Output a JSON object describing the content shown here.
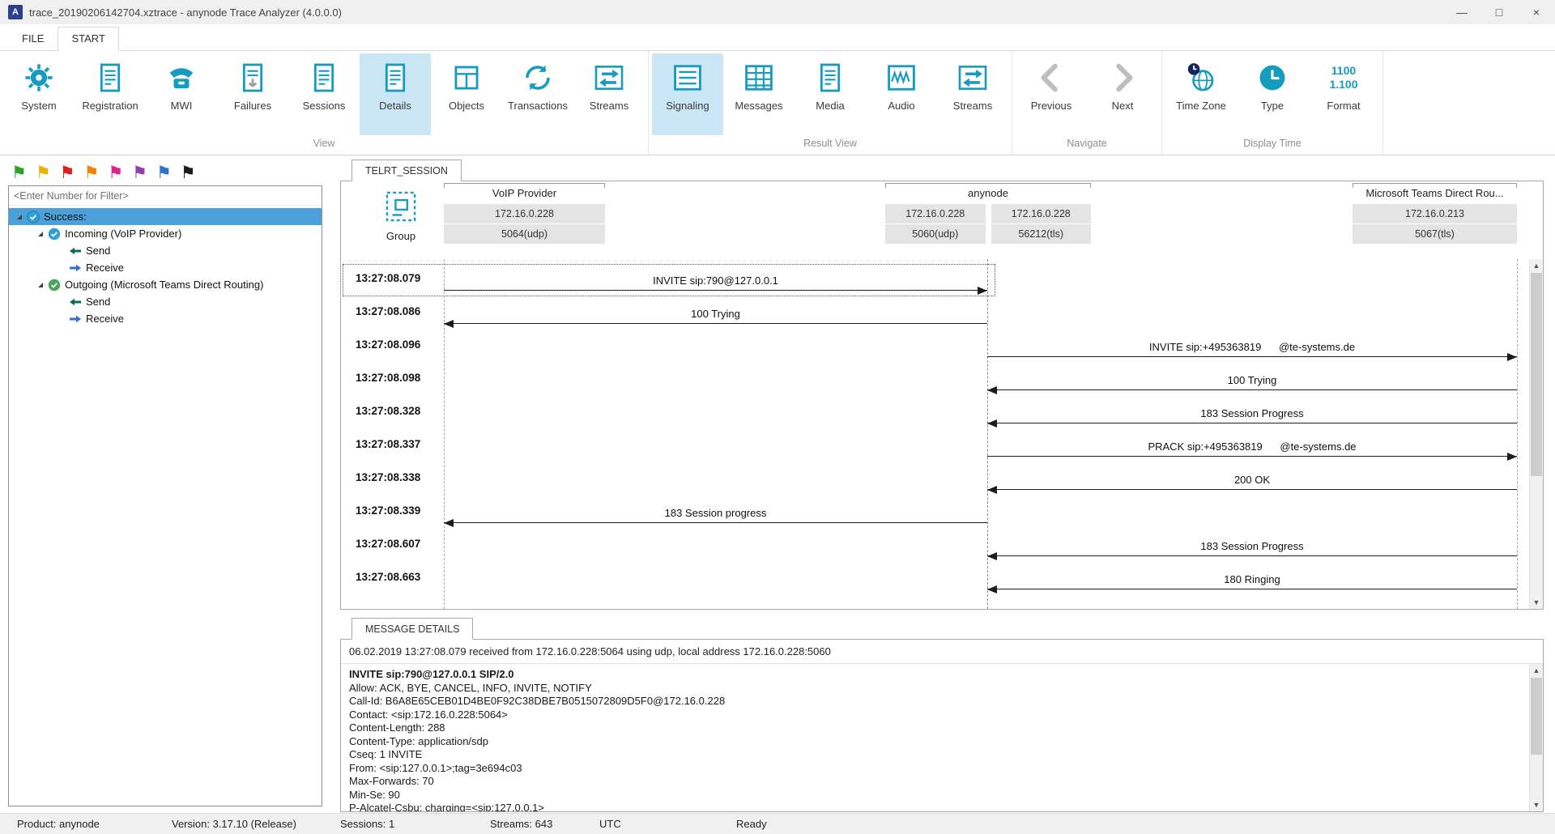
{
  "window": {
    "title": "trace_20190206142704.xztrace - anynode Trace Analyzer (4.0.0.0)",
    "controls": {
      "minimize": "—",
      "maximize": "□",
      "close": "×"
    }
  },
  "menu": {
    "tabs": [
      {
        "label": "FILE"
      },
      {
        "label": "START",
        "active": true
      }
    ]
  },
  "ribbon": {
    "groups": [
      {
        "label": "View",
        "buttons": [
          {
            "label": "System",
            "icon": "gear"
          },
          {
            "label": "Registration",
            "icon": "doc"
          },
          {
            "label": "MWI",
            "icon": "phone"
          },
          {
            "label": "Failures",
            "icon": "doc-arrow"
          },
          {
            "label": "Sessions",
            "icon": "doc"
          },
          {
            "label": "Details",
            "icon": "doc",
            "active": true
          },
          {
            "label": "Objects",
            "icon": "window"
          },
          {
            "label": "Transactions",
            "icon": "refresh"
          },
          {
            "label": "Streams",
            "icon": "streams-box"
          }
        ]
      },
      {
        "label": "Result View",
        "buttons": [
          {
            "label": "Signaling",
            "icon": "signal-list",
            "active": true
          },
          {
            "label": "Messages",
            "icon": "table-grid"
          },
          {
            "label": "Media",
            "icon": "doc"
          },
          {
            "label": "Audio",
            "icon": "waveform-box"
          },
          {
            "label": "Streams",
            "icon": "streams-box"
          }
        ]
      },
      {
        "label": "Navigate",
        "buttons": [
          {
            "label": "Previous",
            "icon": "chevron-left",
            "disabled": true
          },
          {
            "label": "Next",
            "icon": "chevron-right",
            "disabled": true
          }
        ]
      },
      {
        "label": "Display Time",
        "buttons": [
          {
            "label": "Time Zone",
            "icon": "globe-clock"
          },
          {
            "label": "Type",
            "icon": "clock"
          },
          {
            "label": "Format",
            "icon": "format-text",
            "icon_text": "1100|1.100"
          }
        ]
      }
    ]
  },
  "sidebar": {
    "flags": [
      {
        "name": "green",
        "color": "#2aa52a"
      },
      {
        "name": "yellow",
        "color": "#e3b505"
      },
      {
        "name": "red",
        "color": "#dd1c1c"
      },
      {
        "name": "orange",
        "color": "#f08200"
      },
      {
        "name": "magenta",
        "color": "#e0218a"
      },
      {
        "name": "purple",
        "color": "#8d3daf"
      },
      {
        "name": "blue",
        "color": "#2e6fd0"
      },
      {
        "name": "black",
        "color": "#1a1a1a"
      }
    ],
    "filter_placeholder": "<Enter Number for Filter>",
    "tree": [
      {
        "label": "Success:",
        "level": 0,
        "icon": "status-success",
        "expander": true,
        "selected": true
      },
      {
        "label": "Incoming (VoIP Provider)",
        "level": 1,
        "icon": "check-circle-blue",
        "expander": true
      },
      {
        "label": "Send",
        "level": 2,
        "icon": "arrow-send"
      },
      {
        "label": "Receive",
        "level": 2,
        "icon": "arrow-receive"
      },
      {
        "label": "Outgoing (Microsoft Teams Direct Routing)",
        "level": 1,
        "icon": "check-circle-green",
        "expander": true
      },
      {
        "label": "Send",
        "level": 2,
        "icon": "arrow-send"
      },
      {
        "label": "Receive",
        "level": 2,
        "icon": "arrow-receive"
      }
    ]
  },
  "session": {
    "tab": "TELRT_SESSION",
    "group_label": "Group",
    "participants": [
      {
        "name": "VoIP Provider",
        "rows": [
          "172.16.0.228",
          "5064(udp)"
        ]
      },
      {
        "name": "anynode",
        "sub": [
          [
            "172.16.0.228",
            "5060(udp)"
          ],
          [
            "172.16.0.228",
            "56212(tls)"
          ]
        ]
      },
      {
        "name": "Microsoft Teams Direct Rou...",
        "rows": [
          "172.16.0.213",
          "5067(tls)"
        ]
      }
    ],
    "messages": [
      {
        "time": "13:27:08.079",
        "label": "INVITE sip:790@127.0.0.1",
        "from": "left",
        "to": "mid",
        "selected": true
      },
      {
        "time": "13:27:08.086",
        "label": "100 Trying",
        "from": "mid",
        "to": "left"
      },
      {
        "time": "13:27:08.096",
        "label": "INVITE sip:+495363819      @te-systems.de",
        "from": "mid",
        "to": "right"
      },
      {
        "time": "13:27:08.098",
        "label": "100 Trying",
        "from": "right",
        "to": "mid"
      },
      {
        "time": "13:27:08.328",
        "label": "183 Session Progress",
        "from": "right",
        "to": "mid"
      },
      {
        "time": "13:27:08.337",
        "label": "PRACK sip:+495363819      @te-systems.de",
        "from": "mid",
        "to": "right"
      },
      {
        "time": "13:27:08.338",
        "label": "200 OK",
        "from": "right",
        "to": "mid"
      },
      {
        "time": "13:27:08.339",
        "label": "183 Session progress",
        "from": "mid",
        "to": "left"
      },
      {
        "time": "13:27:08.607",
        "label": "183 Session Progress",
        "from": "right",
        "to": "mid"
      },
      {
        "time": "13:27:08.663",
        "label": "180 Ringing",
        "from": "right",
        "to": "mid"
      }
    ]
  },
  "details": {
    "tab": "MESSAGE DETAILS",
    "info": "06.02.2019 13:27:08.079 received from 172.16.0.228:5064 using udp, local address 172.16.0.228:5060",
    "lines": [
      {
        "text": "INVITE sip:790@127.0.0.1 SIP/2.0",
        "bold": true
      },
      {
        "text": "Allow: ACK, BYE, CANCEL, INFO, INVITE, NOTIFY"
      },
      {
        "text": "Call-Id: B6A8E65CEB01D4BE0F92C38DBE7B0515072809D5F0@172.16.0.228"
      },
      {
        "text": "Contact: <sip:172.16.0.228:5064>"
      },
      {
        "text": "Content-Length: 288"
      },
      {
        "text": "Content-Type: application/sdp"
      },
      {
        "text": "Cseq: 1 INVITE"
      },
      {
        "text": "From: <sip:127.0.0.1>;tag=3e694c03"
      },
      {
        "text": "Max-Forwards: 70"
      },
      {
        "text": "Min-Se: 90"
      },
      {
        "text": "P-Alcatel-Csbu: charging=<sip:127.0.0.1>"
      }
    ]
  },
  "statusbar": {
    "items": [
      {
        "label": "Product: anynode"
      },
      {
        "label": "Version: 3.17.10 (Release)"
      },
      {
        "label": "Sessions: 1"
      },
      {
        "label": "Streams: 643"
      },
      {
        "label": "UTC"
      },
      {
        "label": "Ready"
      }
    ]
  }
}
